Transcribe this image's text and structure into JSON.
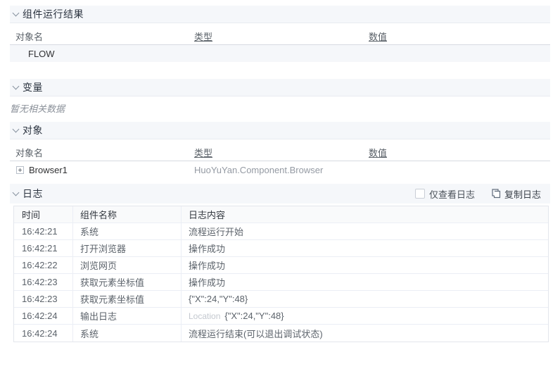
{
  "sections": {
    "results": {
      "title": "组件运行结果",
      "columns": [
        "对象名",
        "类型",
        "数值"
      ],
      "rows": [
        {
          "name": "FLOW",
          "type": "",
          "value": ""
        }
      ]
    },
    "variables": {
      "title": "变量",
      "empty_text": "暂无相关数据"
    },
    "objects": {
      "title": "对象",
      "columns": [
        "对象名",
        "类型",
        "数值"
      ],
      "rows": [
        {
          "name": "Browser1",
          "type": "HuoYuYan.Component.Browser",
          "value": ""
        }
      ]
    },
    "logs": {
      "title": "日志",
      "only_view_label": "仅查看日志",
      "copy_label": "复制日志",
      "columns": [
        "时间",
        "组件名称",
        "日志内容"
      ],
      "rows": [
        {
          "time": "16:42:21",
          "component": "系统",
          "tag": "",
          "content": "流程运行开始"
        },
        {
          "time": "16:42:21",
          "component": "打开浏览器",
          "tag": "",
          "content": "操作成功"
        },
        {
          "time": "16:42:22",
          "component": "浏览网页",
          "tag": "",
          "content": "操作成功"
        },
        {
          "time": "16:42:23",
          "component": "获取元素坐标值",
          "tag": "",
          "content": "操作成功"
        },
        {
          "time": "16:42:23",
          "component": "获取元素坐标值",
          "tag": "",
          "content": "{\"X\":24,\"Y\":48}"
        },
        {
          "time": "16:42:24",
          "component": "输出日志",
          "tag": "Location",
          "content": "{\"X\":24,\"Y\":48}"
        },
        {
          "time": "16:42:24",
          "component": "系统",
          "tag": "",
          "content": "流程运行结束(可以退出调试状态)"
        }
      ]
    }
  },
  "colors": {
    "section_bg": "#f5f7fa",
    "stripe_bg": "#f5f7fa",
    "border_light": "#ebeef5",
    "text_dark": "#303133",
    "text_gray": "#949aa3",
    "text_light": "#c3c8cf"
  }
}
